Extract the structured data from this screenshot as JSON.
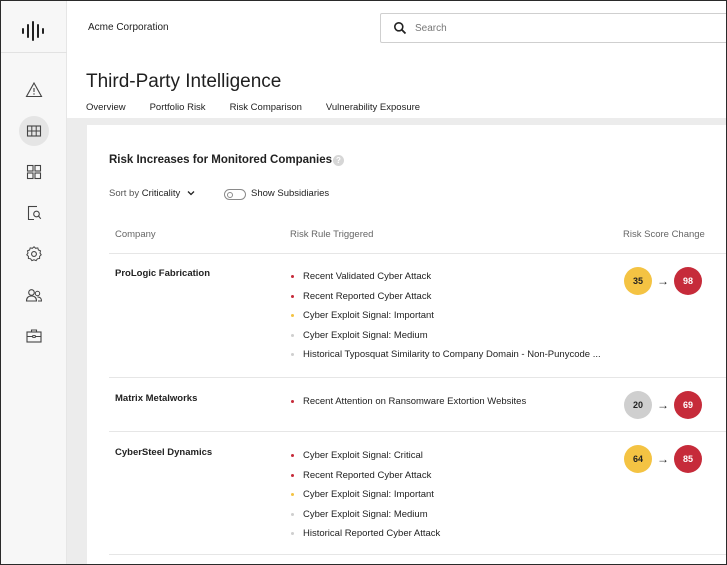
{
  "org_name": "Acme Corporation",
  "search": {
    "placeholder": "Search"
  },
  "sidebar": {
    "items": [
      {
        "icon": "alert-triangle-icon"
      },
      {
        "icon": "grid-table-icon",
        "active": true
      },
      {
        "icon": "dashboard-icon"
      },
      {
        "icon": "document-search-icon"
      },
      {
        "icon": "gear-icon"
      },
      {
        "icon": "users-icon"
      },
      {
        "icon": "briefcase-icon"
      }
    ]
  },
  "page": {
    "title": "Third-Party Intelligence",
    "tabs": [
      {
        "label": "Overview",
        "active": true
      },
      {
        "label": "Portfolio Risk"
      },
      {
        "label": "Risk Comparison"
      },
      {
        "label": "Vulnerability Exposure"
      }
    ]
  },
  "card": {
    "title": "Risk Increases for Monitored Companies",
    "help_icon": "?",
    "sort_prefix": "Sort by",
    "sort_value": "Criticality",
    "toggle_label": "Show Subsidiaries",
    "toggle_on": false,
    "columns": {
      "company": "Company",
      "rule": "Risk Rule Triggered",
      "score": "Risk Score Change"
    }
  },
  "colors": {
    "critical": "#c62b3a",
    "high": "#f4c343",
    "low": "#cfcfcf"
  },
  "rows": [
    {
      "company": "ProLogic Fabrication",
      "rules": [
        {
          "text": "Recent Validated Cyber Attack",
          "severity": "critical"
        },
        {
          "text": "Recent Reported Cyber Attack",
          "severity": "critical"
        },
        {
          "text": "Cyber Exploit Signal: Important",
          "severity": "high"
        },
        {
          "text": "Cyber Exploit Signal: Medium",
          "severity": "low"
        },
        {
          "text": "Historical Typosquat Similarity to Company Domain - Non-Punycode ...",
          "severity": "low"
        }
      ],
      "score_from": "35",
      "from_severity": "high",
      "score_to": "98",
      "to_severity": "critical"
    },
    {
      "company": "Matrix Metalworks",
      "rules": [
        {
          "text": "Recent Attention on Ransomware Extortion Websites",
          "severity": "critical"
        }
      ],
      "score_from": "20",
      "from_severity": "low",
      "score_to": "69",
      "to_severity": "critical"
    },
    {
      "company": "CyberSteel Dynamics",
      "rules": [
        {
          "text": "Cyber Exploit Signal: Critical",
          "severity": "critical"
        },
        {
          "text": "Recent Reported Cyber Attack",
          "severity": "critical"
        },
        {
          "text": "Cyber Exploit Signal: Important",
          "severity": "high"
        },
        {
          "text": "Cyber Exploit Signal: Medium",
          "severity": "low"
        },
        {
          "text": "Historical Reported Cyber Attack",
          "severity": "low"
        }
      ],
      "score_from": "64",
      "from_severity": "high",
      "score_to": "85",
      "to_severity": "critical"
    }
  ]
}
